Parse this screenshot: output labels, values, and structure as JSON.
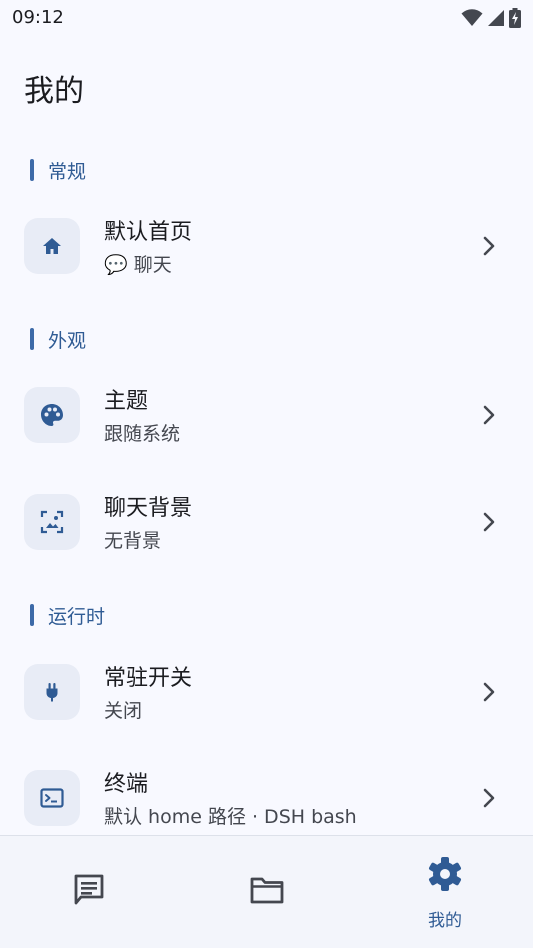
{
  "status_bar": {
    "time": "09:12",
    "icons": [
      "wifi-icon",
      "signal-icon",
      "battery-charging-icon"
    ]
  },
  "page": {
    "title": "我的"
  },
  "sections": [
    {
      "label": "常规"
    },
    {
      "label": "外观"
    },
    {
      "label": "运行时"
    }
  ],
  "items": [
    {
      "title": "默认首页",
      "subtitle": "💬 聊天",
      "icon": "home-icon"
    },
    {
      "title": "主题",
      "subtitle": "跟随系统",
      "icon": "palette-icon"
    },
    {
      "title": "聊天背景",
      "subtitle": "无背景",
      "icon": "wallpaper-icon"
    },
    {
      "title": "常驻开关",
      "subtitle": "关闭",
      "icon": "plug-icon"
    },
    {
      "title": "终端",
      "subtitle": "默认 home 路径 · DSH bash",
      "icon": "terminal-icon"
    }
  ],
  "bottom_nav": {
    "items": [
      {
        "icon": "chat-icon",
        "label": ""
      },
      {
        "icon": "folder-icon",
        "label": ""
      },
      {
        "icon": "settings-icon",
        "label": "我的",
        "selected": true
      }
    ]
  },
  "colors": {
    "background": "#f8f9ff",
    "accent": "#2f5b94",
    "icon_box": "#e8ecf6"
  }
}
